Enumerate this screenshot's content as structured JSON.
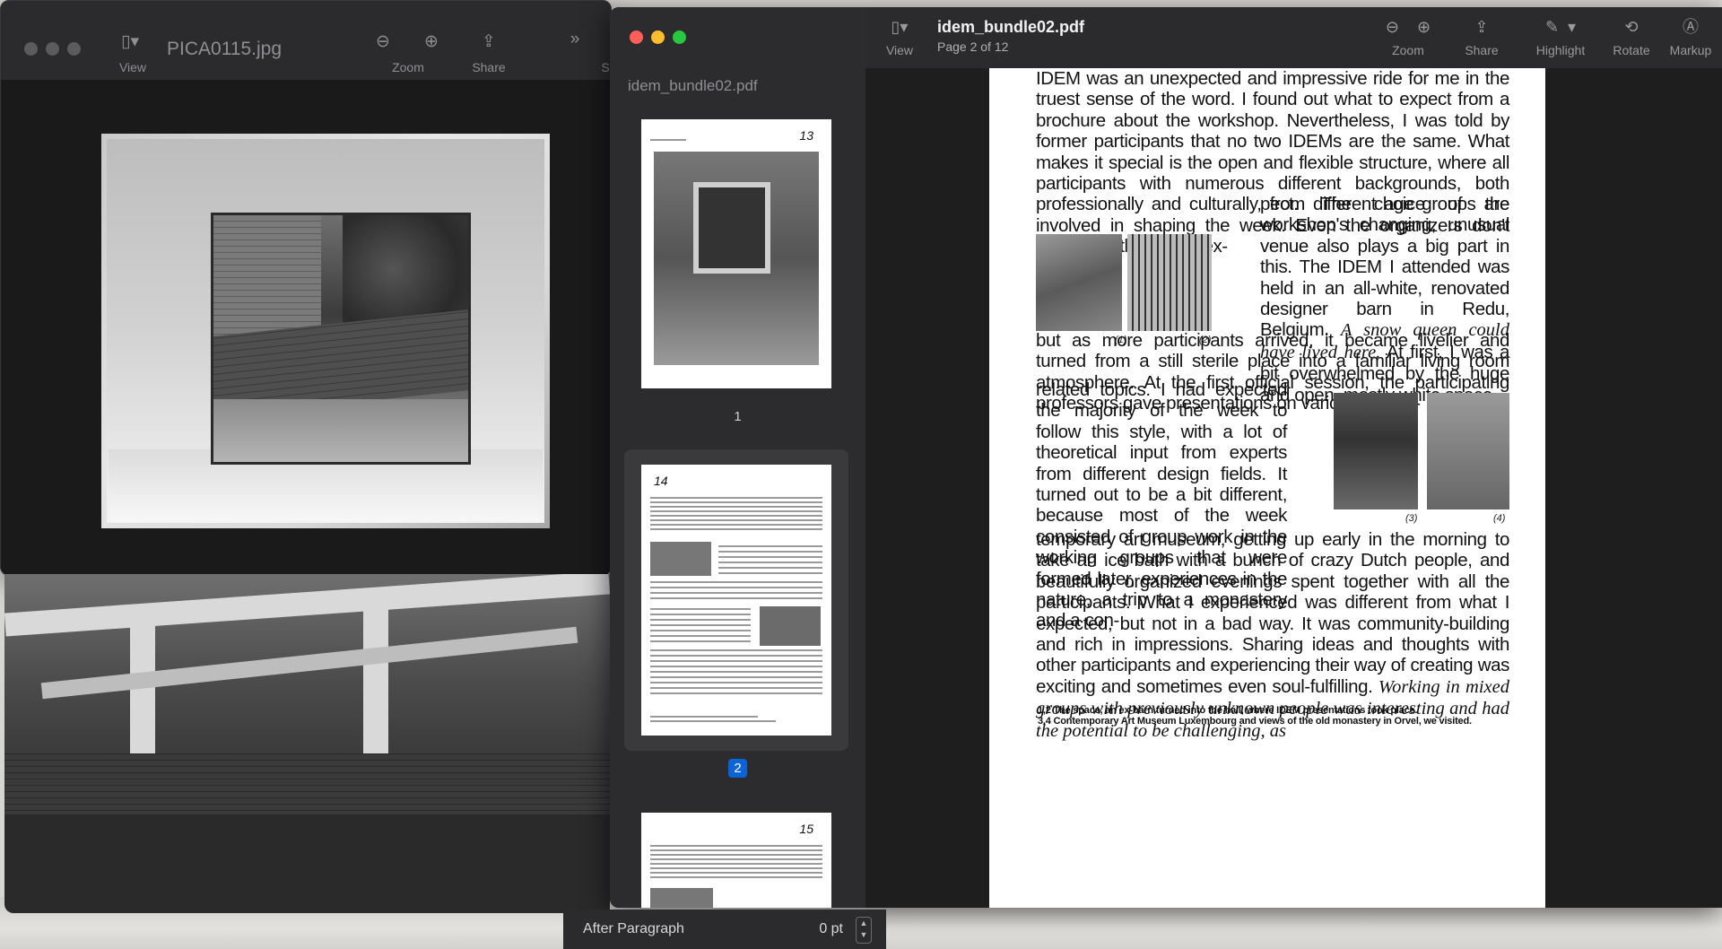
{
  "image_window": {
    "title": "PICA0115.jpg",
    "toolbar": {
      "view": "View",
      "zoom": "Zoom",
      "share": "Share",
      "more": "»",
      "cut_label": "S"
    }
  },
  "pdf_window": {
    "title": "idem_bundle02.pdf",
    "subtitle": "Page 2 of 12",
    "sidebar_title": "idem_bundle02.pdf",
    "toolbar": {
      "view": "View",
      "zoom": "Zoom",
      "share": "Share",
      "highlight": "Highlight",
      "rotate": "Rotate",
      "markup": "Markup"
    },
    "thumbnails": [
      {
        "label": "1",
        "page_no": "13",
        "selected": false
      },
      {
        "label": "2",
        "page_no": "14",
        "selected": true
      },
      {
        "label": "",
        "page_no": "15",
        "selected": false
      }
    ],
    "page": {
      "para1": "IDEM was an unexpected and impressive ride for me in the truest sense of the word. I found out what to expect from a brochure about the workshop. Nevertheless, I was told by former participants that no two IDEMs are the same. What makes it special is the open and flexible structure, where all participants with numerous different backgrounds, both professionally and culturally, from different age groups are involved in shaping the week. Even the organizers don't know exactly what to ex-",
      "para2": "pect. The choice of the workshop's changing, unusual venue also plays a big part in this. The IDEM I attended was held in an all-white, renovated designer barn in Redu, Belgium.",
      "para2_italic": "A snow queen could have lived here.",
      "para3": "At first, I was a bit overwhelmed by the huge and open, mostly white space,",
      "para4": "but as more participants arrived, it became livelier and turned from a still sterile place into a familiar living room atmosphere. At the first official session, the participating professors gave presentations on various design-",
      "para5": "related topics. I had expected the majority of the week to follow this style, with a lot of theoretical input from experts from different design fields. It turned out to be a bit different, because most of the week consisted of group work in the working groups that were formed later, experiences in the nature, a trip to a monastery and a con-",
      "para6": "temporary art museum, getting up early in the morning to take an ice bath with a bunch of crazy Dutch people, and beautifully organized evenings spent together with all the participants. What I experienced was different from what I expected, but not in a bad way. It was community-building and rich in impressions. Sharing ideas and thoughts with other participants and experiencing their way of creating was exciting and sometimes even soul-fulfilling.",
      "para6_italic": "Working in mixed groups with previously unknown people was interesting and had the potential to be challenging, as",
      "captions": [
        "(1)",
        "(2)",
        "(3)",
        "(4)"
      ],
      "footnote1": "1,2 The space, an ex-barn turned into the hall, where IDEM presentations took place.",
      "footnote2": "3,4 Contemporary Art Museum Luxembourg and views of the old monastery in Orvel, we visited."
    }
  },
  "format_bar": {
    "label": "After Paragraph",
    "value": "0 pt"
  },
  "colors": {
    "selection": "#0a64d8",
    "window_bg": "#1e1e1e",
    "toolbar_bg": "#2b2b2d"
  }
}
